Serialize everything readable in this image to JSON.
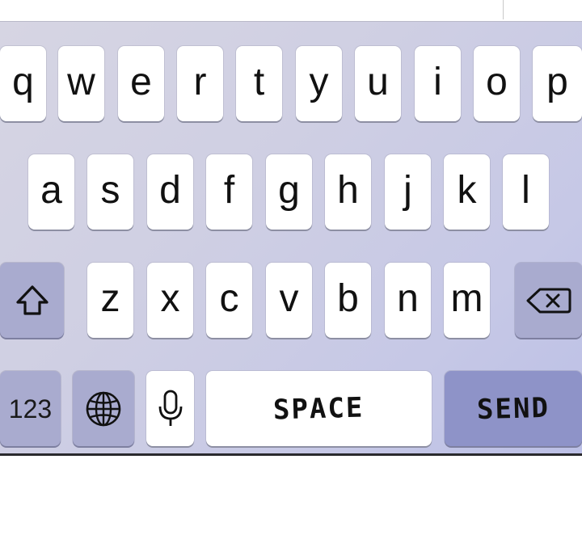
{
  "keyboard": {
    "rows": [
      [
        "q",
        "w",
        "e",
        "r",
        "t",
        "y",
        "u",
        "i",
        "o",
        "p"
      ],
      [
        "a",
        "s",
        "d",
        "f",
        "g",
        "h",
        "j",
        "k",
        "l"
      ],
      [
        "z",
        "x",
        "c",
        "v",
        "b",
        "n",
        "m"
      ]
    ],
    "numbers_label": "123",
    "space_label": "SPACE",
    "send_label": "SEND",
    "icons": {
      "shift": "shift-icon",
      "delete": "backspace-icon",
      "globe": "globe-icon",
      "mic": "microphone-icon"
    },
    "colors": {
      "background": "#cfcfe3",
      "letter_key": "#ffffff",
      "function_key": "#a9abcf",
      "send_key": "#8e93c8"
    }
  }
}
